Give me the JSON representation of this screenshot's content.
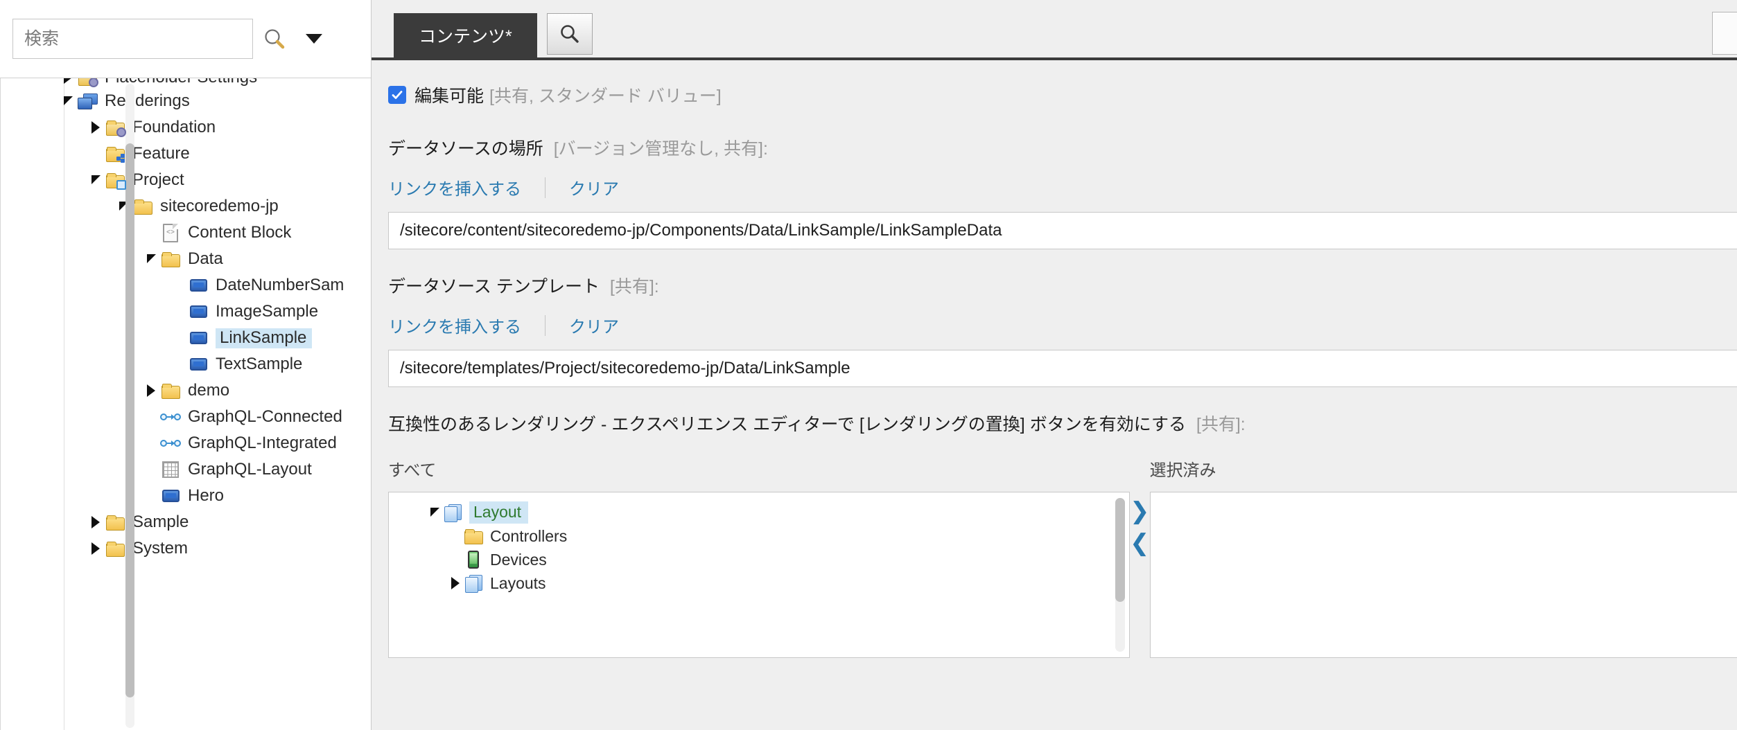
{
  "search": {
    "placeholder": "検索",
    "value": "",
    "icon": "search-icon",
    "caret_icon": "chevron-down-icon"
  },
  "tree": {
    "items": [
      {
        "label": "Placeholder Settings",
        "indent": 1,
        "arrow": "collapsed",
        "icon": "folder-gear-icon",
        "selected": false,
        "clipped": true
      },
      {
        "label": "Renderings",
        "indent": 1,
        "arrow": "expanded",
        "icon": "renderings-icon",
        "selected": false
      },
      {
        "label": "Foundation",
        "indent": 2,
        "arrow": "collapsed",
        "icon": "folder-gear-icon",
        "selected": false
      },
      {
        "label": "Feature",
        "indent": 2,
        "arrow": "none",
        "icon": "folder-blue-icon",
        "selected": false
      },
      {
        "label": "Project",
        "indent": 2,
        "arrow": "expanded",
        "icon": "folder-window-icon",
        "selected": false
      },
      {
        "label": "sitecoredemo-jp",
        "indent": 3,
        "arrow": "expanded",
        "icon": "folder-icon",
        "selected": false
      },
      {
        "label": "Content Block",
        "indent": 4,
        "arrow": "none",
        "icon": "code-file-icon",
        "selected": false
      },
      {
        "label": "Data",
        "indent": 4,
        "arrow": "expanded",
        "icon": "folder-icon",
        "selected": false
      },
      {
        "label": "DateNumberSam",
        "indent": 5,
        "arrow": "none",
        "icon": "rendering-icon",
        "selected": false
      },
      {
        "label": "ImageSample",
        "indent": 5,
        "arrow": "none",
        "icon": "rendering-icon",
        "selected": false
      },
      {
        "label": "LinkSample",
        "indent": 5,
        "arrow": "none",
        "icon": "rendering-icon",
        "selected": true
      },
      {
        "label": "TextSample",
        "indent": 5,
        "arrow": "none",
        "icon": "rendering-icon",
        "selected": false
      },
      {
        "label": "demo",
        "indent": 4,
        "arrow": "collapsed",
        "icon": "folder-icon",
        "selected": false
      },
      {
        "label": "GraphQL-Connected",
        "indent": 4,
        "arrow": "none",
        "icon": "graphql-icon",
        "selected": false
      },
      {
        "label": "GraphQL-Integrated",
        "indent": 4,
        "arrow": "none",
        "icon": "graphql-icon",
        "selected": false
      },
      {
        "label": "GraphQL-Layout",
        "indent": 4,
        "arrow": "none",
        "icon": "grid-icon",
        "selected": false
      },
      {
        "label": "Hero",
        "indent": 4,
        "arrow": "none",
        "icon": "rendering-icon",
        "selected": false
      },
      {
        "label": "Sample",
        "indent": 2,
        "arrow": "collapsed",
        "icon": "folder-icon",
        "selected": false
      },
      {
        "label": "System",
        "indent": 2,
        "arrow": "collapsed",
        "icon": "folder-icon",
        "selected": false
      }
    ]
  },
  "tabs": {
    "active_label": "コンテンツ*",
    "search_button_icon": "search-icon"
  },
  "form": {
    "editable": {
      "label": "編集可能",
      "meta": "[共有, スタンダード バリュー]",
      "checked": true
    },
    "datasource_location": {
      "label": "データソースの場所",
      "meta": "[バージョン管理なし, 共有]:",
      "insert_link_label": "リンクを挿入する",
      "clear_label": "クリア",
      "value": "/sitecore/content/sitecoredemo-jp/Components/Data/LinkSample/LinkSampleData"
    },
    "datasource_template": {
      "label": "データソース テンプレート",
      "meta": "[共有]:",
      "insert_link_label": "リンクを挿入する",
      "clear_label": "クリア",
      "value": "/sitecore/templates/Project/sitecoredemo-jp/Data/LinkSample"
    },
    "compatible_renderings": {
      "label": "互換性のあるレンダリング - エクスペリエンス エディターで [レンダリングの置換] ボタンを有効にする",
      "meta": "[共有]:",
      "all_caption": "すべて",
      "selected_caption": "選択済み",
      "move_right_icon": "chevron-right-icon",
      "move_left_icon": "chevron-left-icon",
      "all_items": [
        {
          "label": "Layout",
          "indent": 1,
          "arrow": "expanded",
          "icon": "layout-stack-icon",
          "selected": true
        },
        {
          "label": "Controllers",
          "indent": 2,
          "arrow": "none",
          "icon": "folder-icon",
          "selected": false
        },
        {
          "label": "Devices",
          "indent": 2,
          "arrow": "none",
          "icon": "device-icon",
          "selected": false
        },
        {
          "label": "Layouts",
          "indent": 2,
          "arrow": "collapsed",
          "icon": "layout-stack-icon",
          "selected": false
        }
      ],
      "selected_items": []
    }
  },
  "colors": {
    "accent_link": "#2a7ab0",
    "tab_active_bg": "#3b3b3b",
    "selection_bg": "#cfe6f5",
    "checkbox_blue": "#2b72e8",
    "green_text": "#2f7a2f"
  }
}
